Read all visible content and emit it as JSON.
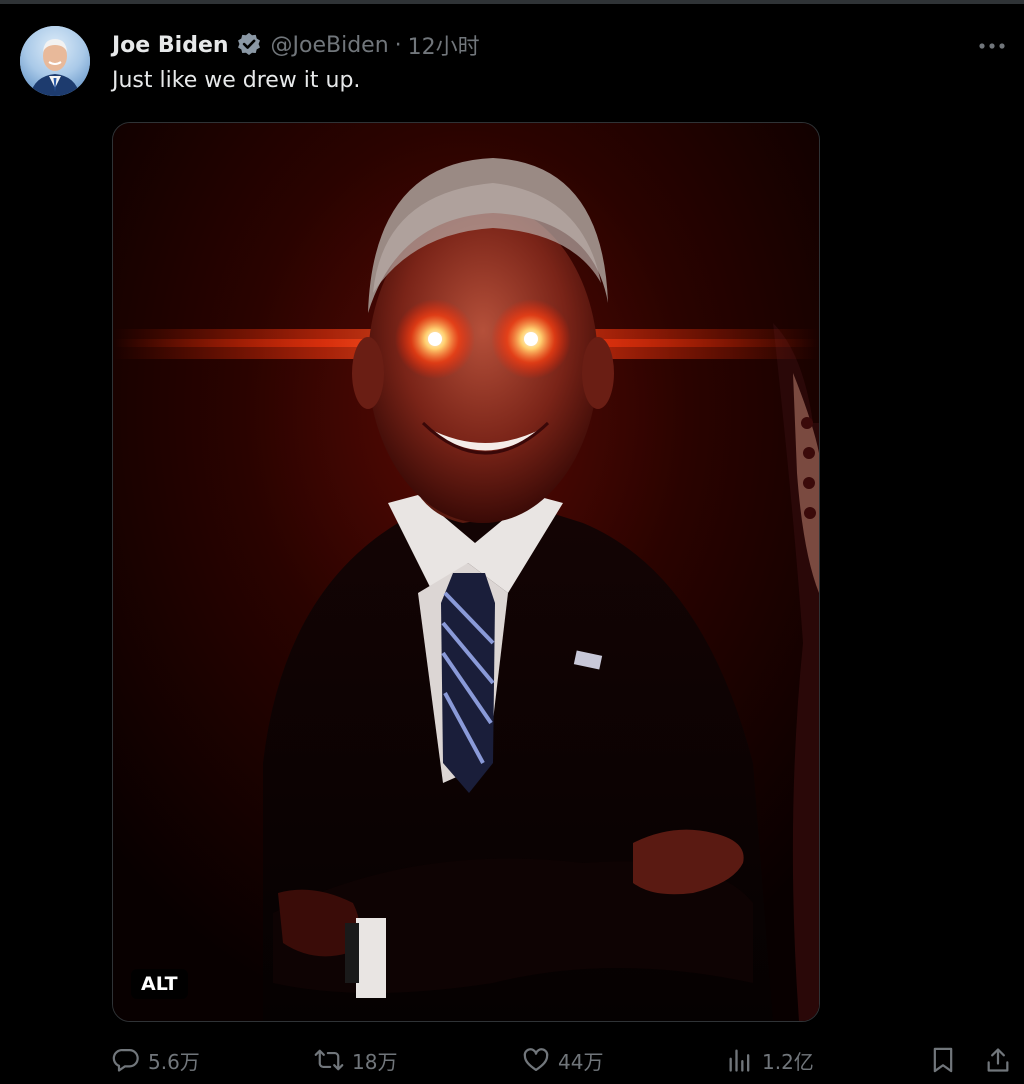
{
  "author": {
    "name": "Joe Biden",
    "handle": "@JoeBiden",
    "separator": "·",
    "time": "12小时",
    "verified": true
  },
  "tweet": {
    "text": "Just like we drew it up."
  },
  "media": {
    "type": "photo",
    "alt_badge": "ALT"
  },
  "actions": {
    "replies": "5.6万",
    "retweets": "18万",
    "likes": "44万",
    "views": "1.2亿"
  },
  "colors": {
    "background": "#000000",
    "text_primary": "#e7e9ea",
    "text_secondary": "#71767b",
    "verified_badge": "#8b98a5",
    "divider": "#2f3336"
  },
  "icons": [
    "verified-badge-icon",
    "more-icon",
    "reply-icon",
    "retweet-icon",
    "like-icon",
    "views-icon",
    "bookmark-icon",
    "share-icon"
  ]
}
